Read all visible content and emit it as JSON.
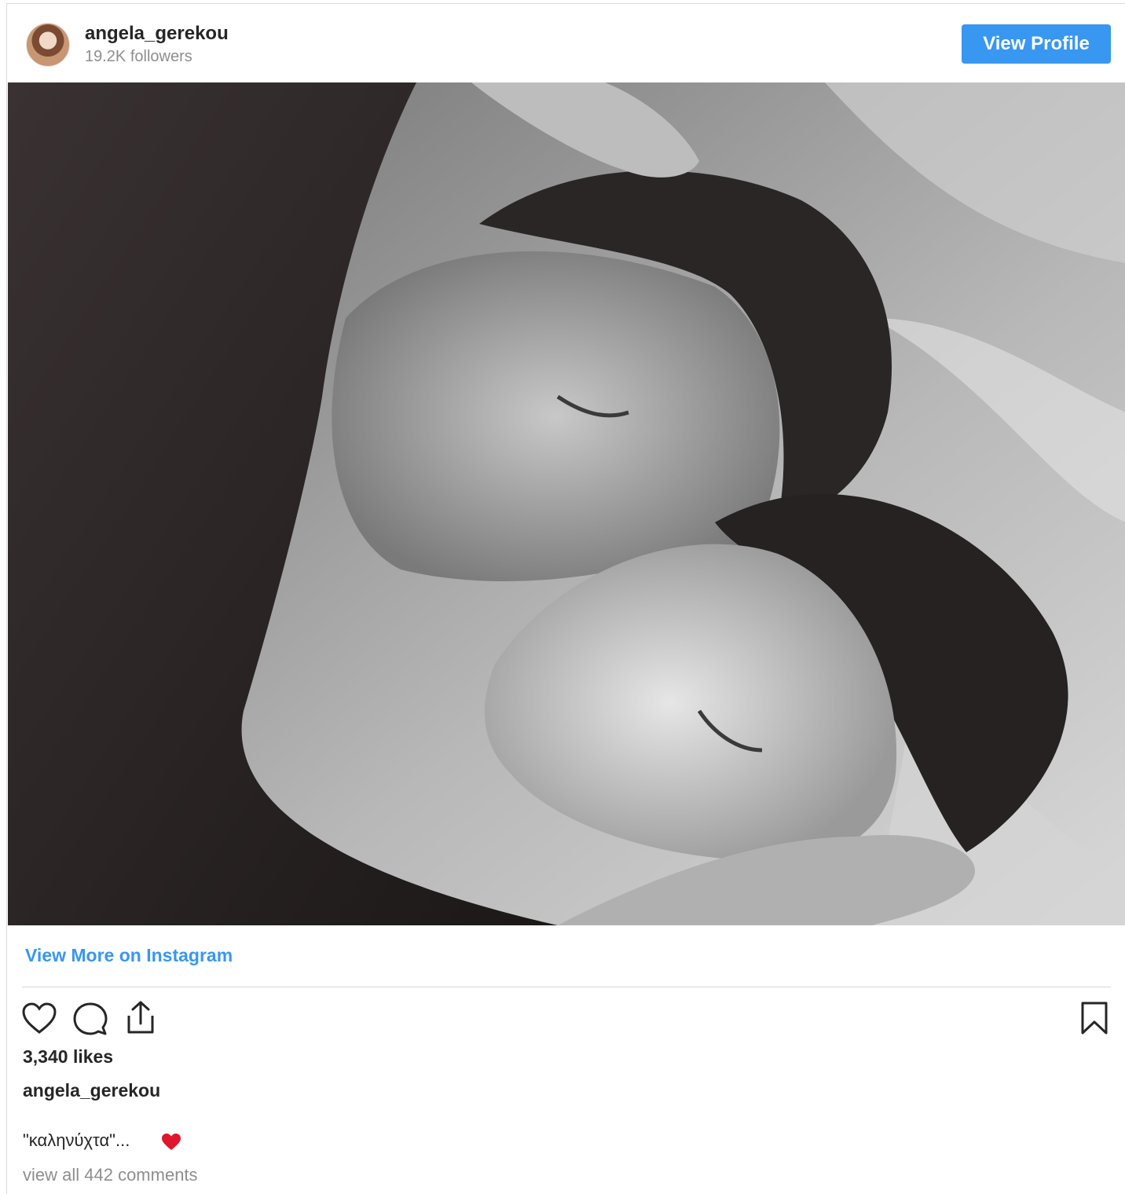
{
  "profile": {
    "username": "angela_gerekou",
    "followers": "19.2K followers",
    "view_profile_label": "View Profile"
  },
  "post": {
    "view_more_label": "View More on Instagram",
    "likes": "3,340 likes",
    "caption_username": "angela_gerekou",
    "caption_text": "\"καληνύχτα\"...",
    "caption_emoji": "red-heart",
    "comments_link": "view all 442 comments"
  },
  "actions": {
    "like_icon": "heart-outline-icon",
    "comment_icon": "comment-bubble-icon",
    "share_icon": "share-upload-icon",
    "save_icon": "bookmark-icon"
  },
  "colors": {
    "accent": "#3897f0",
    "text": "#262626",
    "muted": "#8e8e8e",
    "emoji_heart": "#e0162b"
  }
}
